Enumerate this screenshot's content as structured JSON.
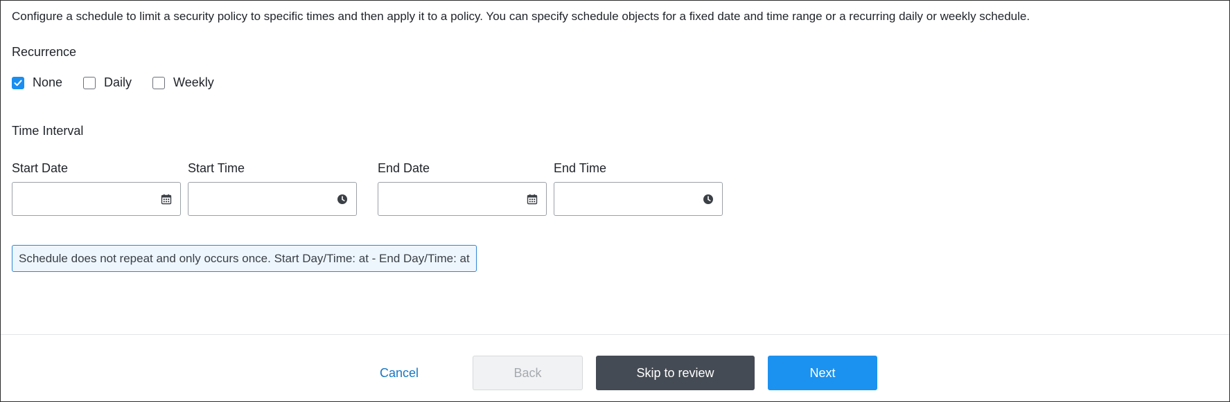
{
  "description": "Configure a schedule to limit a security policy to specific times and then apply it to a policy. You can specify schedule objects for a fixed date and time range or a recurring daily or weekly schedule.",
  "recurrence": {
    "label": "Recurrence",
    "options": [
      {
        "label": "None",
        "checked": true
      },
      {
        "label": "Daily",
        "checked": false
      },
      {
        "label": "Weekly",
        "checked": false
      }
    ]
  },
  "time_interval": {
    "label": "Time Interval",
    "fields": [
      {
        "label": "Start Date",
        "value": "",
        "icon": "calendar-icon"
      },
      {
        "label": "Start Time",
        "value": "",
        "icon": "clock-icon"
      },
      {
        "label": "End Date",
        "value": "",
        "icon": "calendar-icon"
      },
      {
        "label": "End Time",
        "value": "",
        "icon": "clock-icon"
      }
    ]
  },
  "summary": "Schedule does not repeat and only occurs once. Start Day/Time: at - End Day/Time: at",
  "footer": {
    "cancel_label": "Cancel",
    "back_label": "Back",
    "skip_label": "Skip to review",
    "next_label": "Next"
  },
  "colors": {
    "accent": "#1b92f0",
    "link": "#1777c4",
    "dark_button": "#454b54",
    "summary_border": "#2a86d6",
    "summary_bg": "#eef6fd"
  }
}
